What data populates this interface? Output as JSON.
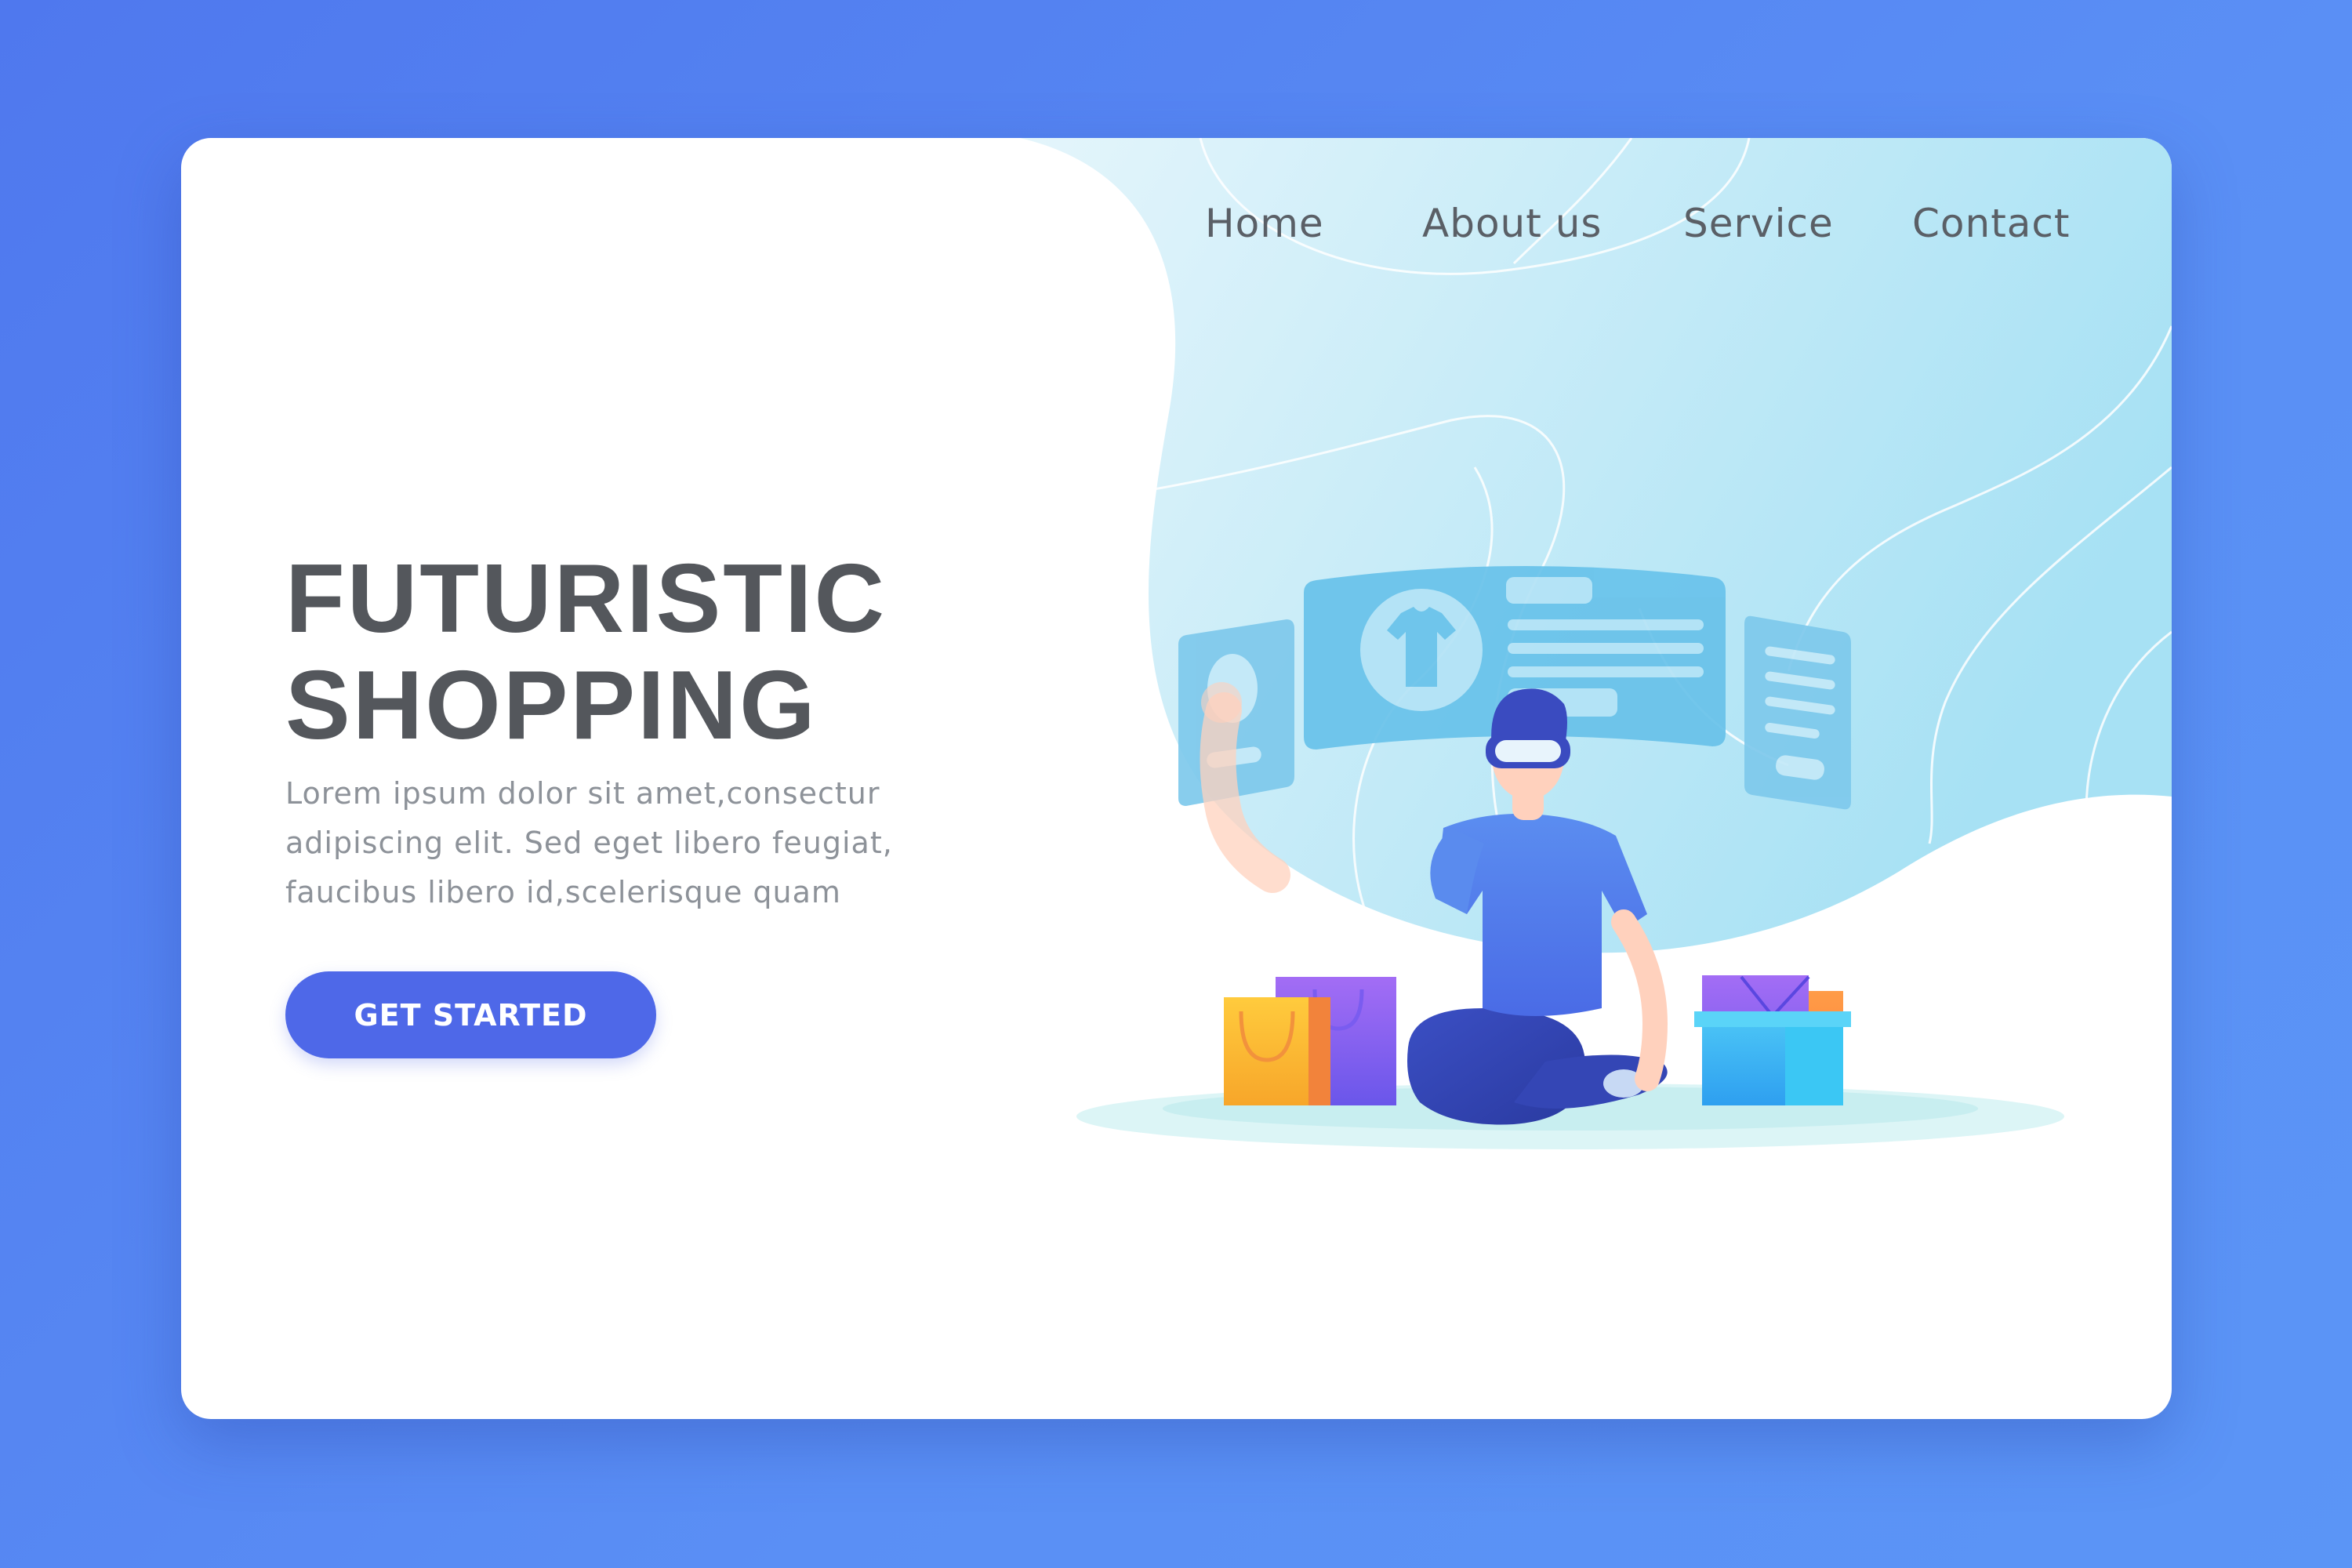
{
  "nav": {
    "items": [
      {
        "label": "Home"
      },
      {
        "label": "About us"
      },
      {
        "label": "Service"
      },
      {
        "label": "Contact"
      }
    ]
  },
  "hero": {
    "title_line1": "FUTURISTIC",
    "title_line2": "SHOPPING",
    "description": "Lorem ipsum dolor sit amet,consectur adipiscing elit. Sed eget libero feugiat, faucibus libero id,scelerisque quam",
    "cta_label": "GET STARTED"
  },
  "colors": {
    "page_background": "#5283f1",
    "card_background": "#ffffff",
    "accent": "#4e68e8",
    "heading": "#54575c",
    "body_text": "#8d9299",
    "nav_text": "#5a5f66",
    "sky_gradient_start": "#dff3fa",
    "sky_gradient_end": "#a9e2f4"
  },
  "illustration": {
    "subject": "person-wearing-vr-headset-shopping",
    "panels": [
      "profile-card-panel",
      "product-detail-panel",
      "text-list-panel"
    ],
    "product_icon": "t-shirt-icon",
    "items": [
      "shopping-bag-yellow",
      "shopping-bag-purple",
      "gift-box-purple",
      "gift-box-orange",
      "gift-box-cyan"
    ]
  }
}
